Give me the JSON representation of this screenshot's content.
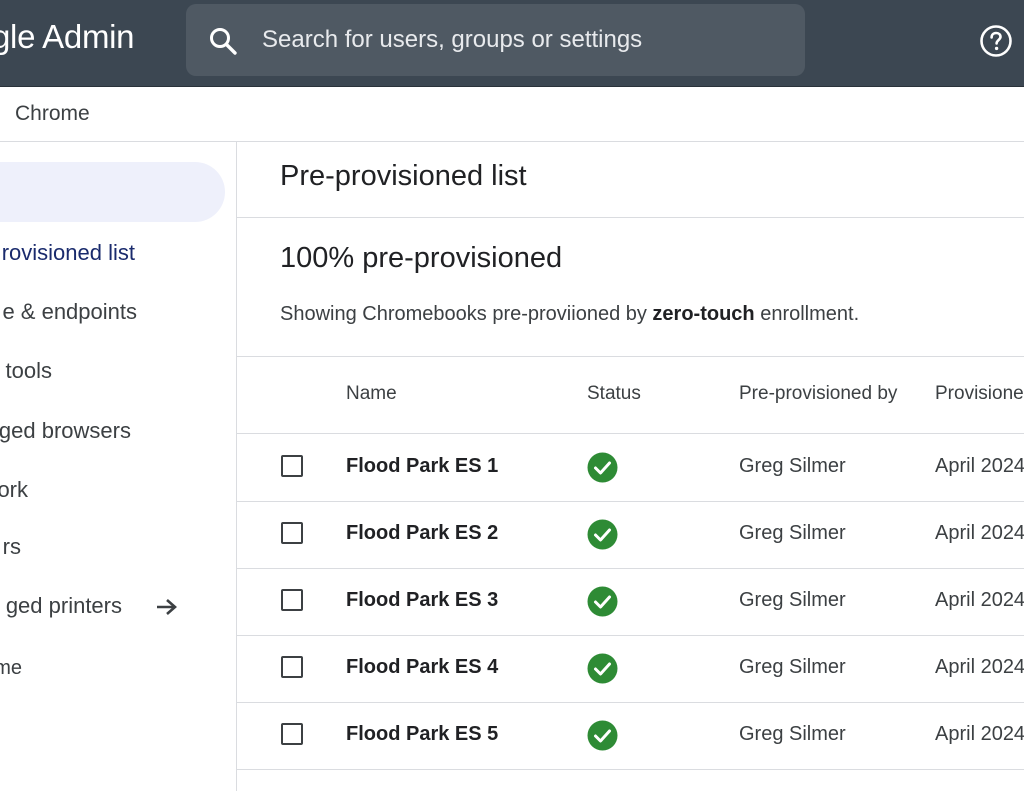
{
  "header": {
    "brand": "gle Admin",
    "search_placeholder": "Search for users, groups or settings"
  },
  "breadcrumb": {
    "current": "Chrome"
  },
  "sidebar": {
    "items": [
      {
        "label": "rovisioned list",
        "active": true
      },
      {
        "label": "e & endpoints"
      },
      {
        "label": " tools"
      },
      {
        "label": "ged browsers"
      },
      {
        "label": "ork"
      },
      {
        "label": "rs"
      },
      {
        "label": "ged printers"
      },
      {
        "label": "me"
      }
    ]
  },
  "main": {
    "title": "Pre-provisioned list",
    "stat_title": "100% pre-provisioned",
    "desc_prefix": "Showing Chromebooks pre-proviioned by ",
    "desc_bold": "zero-touch",
    "desc_suffix": " enrollment."
  },
  "table": {
    "headers": {
      "name": "Name",
      "status": "Status",
      "by": "Pre-provisioned by",
      "date": "Provisione"
    },
    "rows": [
      {
        "name": "Flood Park ES 1",
        "status": "success",
        "by": "Greg Silmer",
        "date": "April 2024"
      },
      {
        "name": "Flood Park ES 2",
        "status": "success",
        "by": "Greg Silmer",
        "date": "April 2024"
      },
      {
        "name": "Flood Park ES 3",
        "status": "success",
        "by": "Greg Silmer",
        "date": "April 2024"
      },
      {
        "name": "Flood Park ES 4",
        "status": "success",
        "by": "Greg Silmer",
        "date": "April 2024"
      },
      {
        "name": "Flood Park ES 5",
        "status": "success",
        "by": "Greg Silmer",
        "date": "April 2024"
      }
    ]
  },
  "colors": {
    "topbar": "#3c4752",
    "search_box": "#4f5963",
    "active_pill": "#eef0fb",
    "status_green": "#2e8b35"
  }
}
